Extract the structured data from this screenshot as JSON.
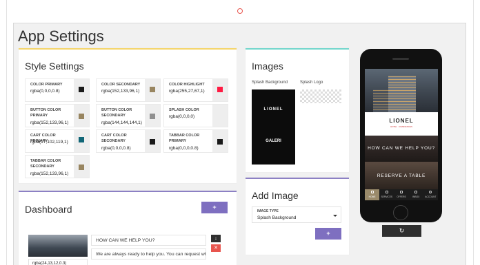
{
  "page": {
    "title": "App Settings"
  },
  "style_settings": {
    "title": "Style Settings",
    "fields": [
      {
        "label": "COLOR PRIMARY",
        "value": "rgba(0,0,0,0.8)",
        "swatch": "#1a1a1a"
      },
      {
        "label": "COLOR SECONDARY",
        "value": "rgba(152,133,96,1)",
        "swatch": "#988560"
      },
      {
        "label": "COLOR HIGHLIGHT",
        "value": "rgba(255,27,67,1)",
        "swatch": "#ff1b43"
      },
      {
        "label": "BUTTON COLOR PRIMARY",
        "value": "rgba(152,133,96,1)",
        "swatch": "#988560"
      },
      {
        "label": "BUTTON COLOR SECONDARY",
        "value": "rgba(144,144,144,1)",
        "swatch": "#909090"
      },
      {
        "label": "SPLASH COLOR",
        "value": "rgba(0,0,0,0)",
        "swatch": ""
      },
      {
        "label": "CART COLOR PRIMARY",
        "value": "rgba(17,102,119,1)",
        "swatch": "#116677"
      },
      {
        "label": "CART COLOR SECONDARY",
        "value": "rgba(0,0,0,0.8)",
        "swatch": "#1a1a1a"
      },
      {
        "label": "TABBAR COLOR PRIMARY",
        "value": "rgba(0,0,0,0.8)",
        "swatch": "#1a1a1a"
      },
      {
        "label": "TABBAR COLOR SECONDARY",
        "value": "rgba(152,133,96,1)",
        "swatch": "#988560"
      }
    ]
  },
  "images": {
    "title": "Images",
    "splash_background_label": "Splash Background",
    "splash_logo_label": "Splash Logo",
    "splash_bg_logo_text": "LIONEL",
    "splash_bg_brand_text": "GALERI"
  },
  "add_image": {
    "title": "Add Image",
    "type_label": "IMAGE TYPE",
    "type_value": "Splash Background",
    "add_label": "+"
  },
  "dashboard": {
    "title": "Dashboard",
    "add_label": "+",
    "item": {
      "title_value": "HOW CAN WE HELP YOU?",
      "text_value": "We are always ready to help you. You can request wh",
      "color_value": "rgba(24,13,12,0.3)",
      "down_label": "↓",
      "delete_label": "✕"
    }
  },
  "preview": {
    "logo_text": "LIONEL",
    "logo_tagline": "HOTEL · RESIDENCES",
    "help_text": "HOW CAN WE HELP YOU?",
    "reserve_text": "RESERVE A TABLE",
    "tabs": [
      "HOME",
      "SERVICES",
      "OFFERS",
      "INBOX",
      "ACCOUNT"
    ],
    "refresh_label": "↻"
  },
  "colors": {
    "accent": "#7e6fc0",
    "style_border": "#f4d56a",
    "images_border": "#72d6cc",
    "highlight": "#e8554e"
  }
}
